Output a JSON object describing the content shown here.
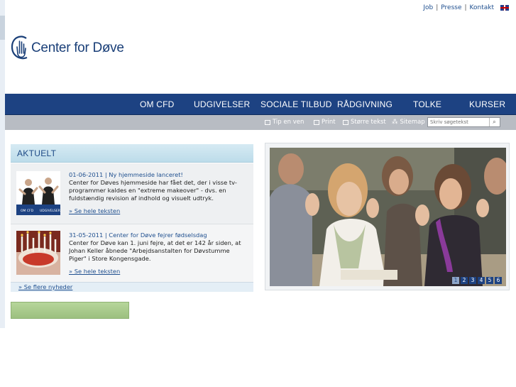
{
  "toplinks": {
    "job": "Job",
    "presse": "Presse",
    "kontakt": "Kontakt",
    "sep1": "|",
    "sep2": "|"
  },
  "logo": {
    "text": "Center for Døve"
  },
  "nav": [
    {
      "label": "OM CFD"
    },
    {
      "label": "UDGIVELSER"
    },
    {
      "label": "SOCIALE TILBUD"
    },
    {
      "label": "RÅDGIVNING"
    },
    {
      "label": "TOLKE"
    },
    {
      "label": "KURSER"
    }
  ],
  "tools": {
    "tip": "Tip en ven",
    "print": "Print",
    "bigger": "Større tekst",
    "sitemap": "Sitemap"
  },
  "search": {
    "placeholder": "Skriv søgetekst"
  },
  "news": {
    "heading": "AKTUELT",
    "items": [
      {
        "date": "01-06-2011 | Ny hjemmeside lanceret!",
        "text": "Center for Døves hjemmeside har fået det, der i visse tv-programmer kaldes en \"extreme makeover\" - dvs. en fuldstændig revision af indhold og visuelt udtryk.",
        "more": "» Se hele teksten",
        "thumb_caption_left": "OM CFD",
        "thumb_caption_right": "UDGIVELSER"
      },
      {
        "date": "31-05-2011 | Center for Døve fejrer fødselsdag",
        "text": "Center for Døve kan 1. juni fejre, at det er 142 år siden, at Johan Keller åbnede \"Arbejdsanstalten for Døvstumme Piger\" i Store Kongensgade.",
        "more": "» Se hele teksten"
      }
    ],
    "see_more": "» Se flere nyheder"
  },
  "slideshow": {
    "pages": [
      "1",
      "2",
      "3",
      "4",
      "5",
      "6"
    ],
    "active_page": 1
  },
  "colors": {
    "nav_blue": "#1d4282",
    "link_blue": "#1f4f8f",
    "subbar_grey": "#b8bcc3",
    "news_head": "#bcdcea"
  }
}
